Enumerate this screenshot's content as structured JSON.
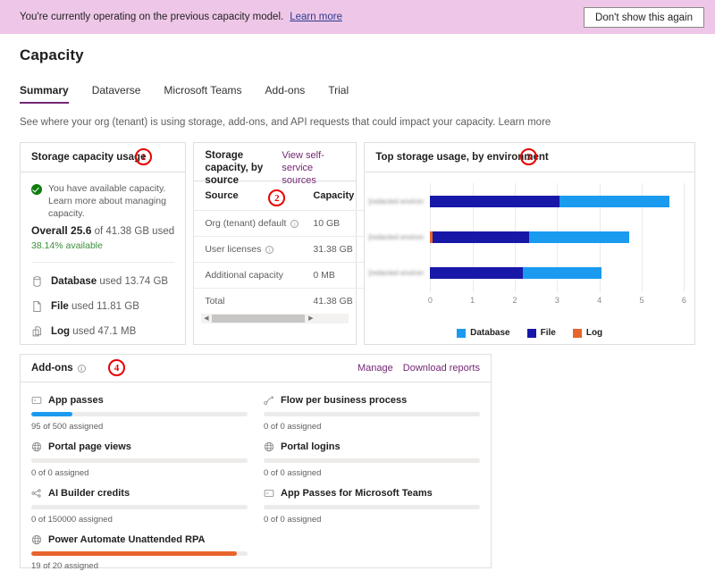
{
  "banner": {
    "text": "You're currently operating on the previous capacity model.",
    "link": "Learn more",
    "dismiss_label": "Don't show this again",
    "bg": "#eec7e8"
  },
  "header": {
    "title": "Capacity",
    "subtitle": "See where your org (tenant) is using storage, add-ons, and API requests that could impact your capacity.",
    "subtitle_link": "Learn more"
  },
  "tabs": [
    {
      "label": "Summary",
      "active": true
    },
    {
      "label": "Dataverse",
      "active": false
    },
    {
      "label": "Microsoft Teams",
      "active": false
    },
    {
      "label": "Add-ons",
      "active": false
    },
    {
      "label": "Trial",
      "active": false
    }
  ],
  "storage_usage_card": {
    "title": "Storage capacity usage",
    "marker": "1",
    "status_text": "You have available capacity. Learn more about managing capacity.",
    "overall_prefix": "Overall",
    "overall_value": "25.6",
    "overall_suffix": "of 41.38 GB used",
    "available": "38.14% available",
    "available_color": "#3a8f3a",
    "items": [
      {
        "icon": "database-icon",
        "name": "Database",
        "value": "used 13.74 GB"
      },
      {
        "icon": "file-icon",
        "name": "File",
        "value": "used 11.81 GB"
      },
      {
        "icon": "log-icon",
        "name": "Log",
        "value": "used 47.1 MB"
      }
    ]
  },
  "source_card": {
    "title": "Storage capacity, by source",
    "header_link": "View self-service sources",
    "marker": "2",
    "columns": [
      "Source",
      "Capacity"
    ],
    "rows": [
      {
        "source": "Org (tenant) default",
        "info": true,
        "capacity": "10 GB"
      },
      {
        "source": "User licenses",
        "info": true,
        "capacity": "31.38 GB"
      },
      {
        "source": "Additional capacity",
        "info": false,
        "capacity": "0 MB"
      },
      {
        "source": "Total",
        "info": false,
        "capacity": "41.38 GB"
      }
    ]
  },
  "environment_card": {
    "title": "Top storage usage, by environment",
    "marker": "3"
  },
  "chart_data": {
    "type": "bar",
    "orientation": "horizontal",
    "stacked": true,
    "title": "Top storage usage, by environment",
    "xlabel": "",
    "ylabel": "",
    "xlim": [
      0,
      6
    ],
    "xticks": [
      0,
      1,
      2,
      3,
      4,
      5,
      6
    ],
    "grid": true,
    "legend_position": "bottom",
    "categories": [
      "[redacted environment 1]",
      "[redacted environment 2]",
      "[redacted environment 3]"
    ],
    "series": [
      {
        "name": "Log",
        "color": "#e8642c",
        "values": [
          0,
          0.05,
          0
        ]
      },
      {
        "name": "File",
        "color": "#1818a8",
        "values": [
          3.06,
          2.28,
          2.2
        ]
      },
      {
        "name": "Database",
        "color": "#1a9bf0",
        "values": [
          2.59,
          2.37,
          1.85
        ]
      }
    ],
    "totals": [
      5.65,
      4.7,
      4.05
    ],
    "legend": [
      "Database",
      "File",
      "Log"
    ]
  },
  "addons_card": {
    "title": "Add-ons",
    "marker": "4",
    "actions": [
      "Manage",
      "Download reports"
    ],
    "items": [
      {
        "icon": "app-passes-icon",
        "label": "App passes",
        "assigned": 95,
        "total": 500,
        "sub": "95 of 500 assigned",
        "percent": 19,
        "color": "#1a9bf0"
      },
      {
        "icon": "flow-icon",
        "label": "Flow per business process",
        "assigned": 0,
        "total": 0,
        "sub": "0 of 0 assigned",
        "percent": 0,
        "color": "#1a9bf0"
      },
      {
        "icon": "portal-icon",
        "label": "Portal page views",
        "assigned": 0,
        "total": 0,
        "sub": "0 of 0 assigned",
        "percent": 0,
        "color": "#1a9bf0"
      },
      {
        "icon": "portal-icon",
        "label": "Portal logins",
        "assigned": 0,
        "total": 0,
        "sub": "0 of 0 assigned",
        "percent": 0,
        "color": "#1a9bf0"
      },
      {
        "icon": "ai-builder-icon",
        "label": "AI Builder credits",
        "assigned": 0,
        "total": 150000,
        "sub": "0 of 150000 assigned",
        "percent": 0,
        "color": "#1a9bf0"
      },
      {
        "icon": "app-passes-icon",
        "label": "App Passes for Microsoft Teams",
        "assigned": 0,
        "total": 0,
        "sub": "0 of 0 assigned",
        "percent": 0,
        "color": "#1a9bf0"
      },
      {
        "icon": "rpa-icon",
        "label": "Power Automate Unattended RPA",
        "assigned": 19,
        "total": 20,
        "sub": "19 of 20 assigned",
        "percent": 95,
        "color": "#e8642c"
      }
    ]
  }
}
